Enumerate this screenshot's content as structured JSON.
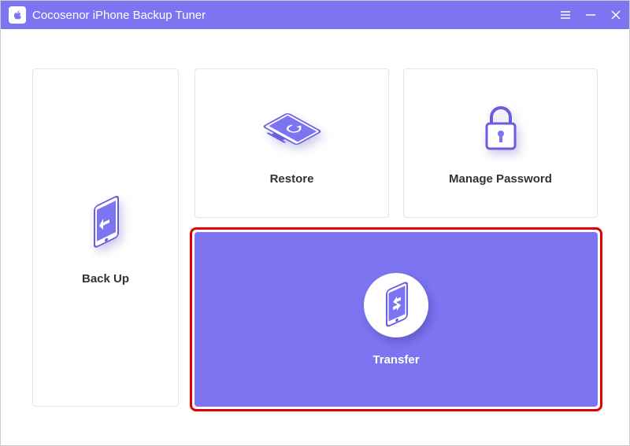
{
  "app": {
    "title": "Cocosenor iPhone Backup Tuner"
  },
  "cards": {
    "backup": {
      "label": "Back Up"
    },
    "restore": {
      "label": "Restore"
    },
    "manage_password": {
      "label": "Manage Password"
    },
    "transfer": {
      "label": "Transfer"
    }
  },
  "colors": {
    "accent": "#7c74f0",
    "highlight": "#e30000"
  }
}
